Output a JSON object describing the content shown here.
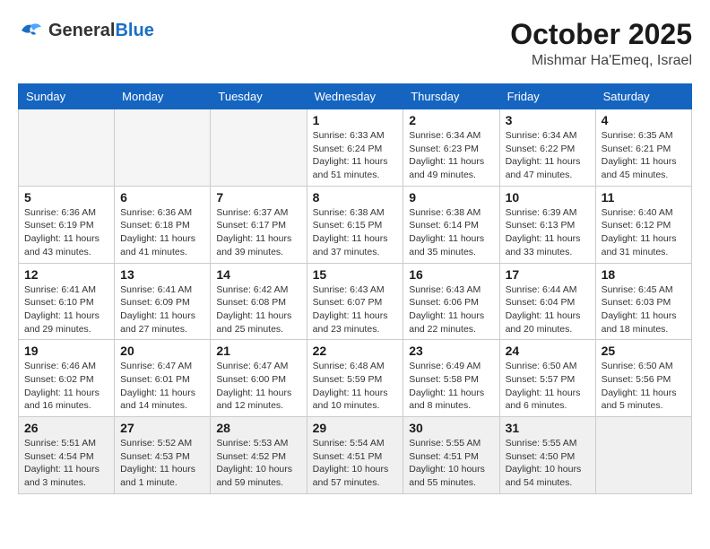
{
  "header": {
    "logo_line1": "General",
    "logo_line2": "Blue",
    "month": "October 2025",
    "location": "Mishmar Ha'Emeq, Israel"
  },
  "weekdays": [
    "Sunday",
    "Monday",
    "Tuesday",
    "Wednesday",
    "Thursday",
    "Friday",
    "Saturday"
  ],
  "weeks": [
    [
      {
        "day": "",
        "empty": true
      },
      {
        "day": "",
        "empty": true
      },
      {
        "day": "",
        "empty": true
      },
      {
        "day": "1",
        "sunrise": "Sunrise: 6:33 AM",
        "sunset": "Sunset: 6:24 PM",
        "daylight": "Daylight: 11 hours and 51 minutes."
      },
      {
        "day": "2",
        "sunrise": "Sunrise: 6:34 AM",
        "sunset": "Sunset: 6:23 PM",
        "daylight": "Daylight: 11 hours and 49 minutes."
      },
      {
        "day": "3",
        "sunrise": "Sunrise: 6:34 AM",
        "sunset": "Sunset: 6:22 PM",
        "daylight": "Daylight: 11 hours and 47 minutes."
      },
      {
        "day": "4",
        "sunrise": "Sunrise: 6:35 AM",
        "sunset": "Sunset: 6:21 PM",
        "daylight": "Daylight: 11 hours and 45 minutes."
      }
    ],
    [
      {
        "day": "5",
        "sunrise": "Sunrise: 6:36 AM",
        "sunset": "Sunset: 6:19 PM",
        "daylight": "Daylight: 11 hours and 43 minutes."
      },
      {
        "day": "6",
        "sunrise": "Sunrise: 6:36 AM",
        "sunset": "Sunset: 6:18 PM",
        "daylight": "Daylight: 11 hours and 41 minutes."
      },
      {
        "day": "7",
        "sunrise": "Sunrise: 6:37 AM",
        "sunset": "Sunset: 6:17 PM",
        "daylight": "Daylight: 11 hours and 39 minutes."
      },
      {
        "day": "8",
        "sunrise": "Sunrise: 6:38 AM",
        "sunset": "Sunset: 6:15 PM",
        "daylight": "Daylight: 11 hours and 37 minutes."
      },
      {
        "day": "9",
        "sunrise": "Sunrise: 6:38 AM",
        "sunset": "Sunset: 6:14 PM",
        "daylight": "Daylight: 11 hours and 35 minutes."
      },
      {
        "day": "10",
        "sunrise": "Sunrise: 6:39 AM",
        "sunset": "Sunset: 6:13 PM",
        "daylight": "Daylight: 11 hours and 33 minutes."
      },
      {
        "day": "11",
        "sunrise": "Sunrise: 6:40 AM",
        "sunset": "Sunset: 6:12 PM",
        "daylight": "Daylight: 11 hours and 31 minutes."
      }
    ],
    [
      {
        "day": "12",
        "sunrise": "Sunrise: 6:41 AM",
        "sunset": "Sunset: 6:10 PM",
        "daylight": "Daylight: 11 hours and 29 minutes."
      },
      {
        "day": "13",
        "sunrise": "Sunrise: 6:41 AM",
        "sunset": "Sunset: 6:09 PM",
        "daylight": "Daylight: 11 hours and 27 minutes."
      },
      {
        "day": "14",
        "sunrise": "Sunrise: 6:42 AM",
        "sunset": "Sunset: 6:08 PM",
        "daylight": "Daylight: 11 hours and 25 minutes."
      },
      {
        "day": "15",
        "sunrise": "Sunrise: 6:43 AM",
        "sunset": "Sunset: 6:07 PM",
        "daylight": "Daylight: 11 hours and 23 minutes."
      },
      {
        "day": "16",
        "sunrise": "Sunrise: 6:43 AM",
        "sunset": "Sunset: 6:06 PM",
        "daylight": "Daylight: 11 hours and 22 minutes."
      },
      {
        "day": "17",
        "sunrise": "Sunrise: 6:44 AM",
        "sunset": "Sunset: 6:04 PM",
        "daylight": "Daylight: 11 hours and 20 minutes."
      },
      {
        "day": "18",
        "sunrise": "Sunrise: 6:45 AM",
        "sunset": "Sunset: 6:03 PM",
        "daylight": "Daylight: 11 hours and 18 minutes."
      }
    ],
    [
      {
        "day": "19",
        "sunrise": "Sunrise: 6:46 AM",
        "sunset": "Sunset: 6:02 PM",
        "daylight": "Daylight: 11 hours and 16 minutes."
      },
      {
        "day": "20",
        "sunrise": "Sunrise: 6:47 AM",
        "sunset": "Sunset: 6:01 PM",
        "daylight": "Daylight: 11 hours and 14 minutes."
      },
      {
        "day": "21",
        "sunrise": "Sunrise: 6:47 AM",
        "sunset": "Sunset: 6:00 PM",
        "daylight": "Daylight: 11 hours and 12 minutes."
      },
      {
        "day": "22",
        "sunrise": "Sunrise: 6:48 AM",
        "sunset": "Sunset: 5:59 PM",
        "daylight": "Daylight: 11 hours and 10 minutes."
      },
      {
        "day": "23",
        "sunrise": "Sunrise: 6:49 AM",
        "sunset": "Sunset: 5:58 PM",
        "daylight": "Daylight: 11 hours and 8 minutes."
      },
      {
        "day": "24",
        "sunrise": "Sunrise: 6:50 AM",
        "sunset": "Sunset: 5:57 PM",
        "daylight": "Daylight: 11 hours and 6 minutes."
      },
      {
        "day": "25",
        "sunrise": "Sunrise: 6:50 AM",
        "sunset": "Sunset: 5:56 PM",
        "daylight": "Daylight: 11 hours and 5 minutes."
      }
    ],
    [
      {
        "day": "26",
        "sunrise": "Sunrise: 5:51 AM",
        "sunset": "Sunset: 4:54 PM",
        "daylight": "Daylight: 11 hours and 3 minutes.",
        "last": true
      },
      {
        "day": "27",
        "sunrise": "Sunrise: 5:52 AM",
        "sunset": "Sunset: 4:53 PM",
        "daylight": "Daylight: 11 hours and 1 minute.",
        "last": true
      },
      {
        "day": "28",
        "sunrise": "Sunrise: 5:53 AM",
        "sunset": "Sunset: 4:52 PM",
        "daylight": "Daylight: 10 hours and 59 minutes.",
        "last": true
      },
      {
        "day": "29",
        "sunrise": "Sunrise: 5:54 AM",
        "sunset": "Sunset: 4:51 PM",
        "daylight": "Daylight: 10 hours and 57 minutes.",
        "last": true
      },
      {
        "day": "30",
        "sunrise": "Sunrise: 5:55 AM",
        "sunset": "Sunset: 4:51 PM",
        "daylight": "Daylight: 10 hours and 55 minutes.",
        "last": true
      },
      {
        "day": "31",
        "sunrise": "Sunrise: 5:55 AM",
        "sunset": "Sunset: 4:50 PM",
        "daylight": "Daylight: 10 hours and 54 minutes.",
        "last": true
      },
      {
        "day": "",
        "empty": true,
        "last": true
      }
    ]
  ]
}
